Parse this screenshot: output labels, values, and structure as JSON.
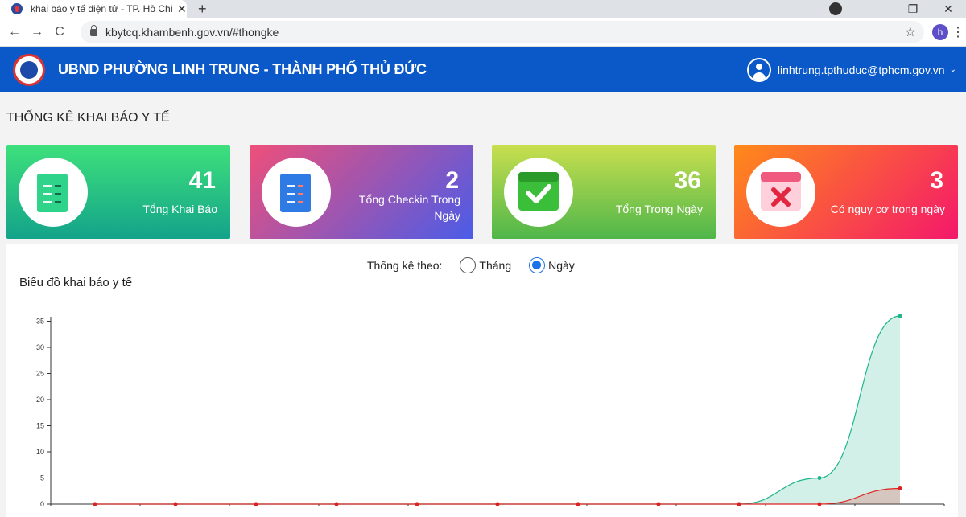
{
  "browser": {
    "tab_title": "khai báo y tế điện tử - TP. Hồ Chí",
    "tab_close": "✕",
    "new_tab": "+",
    "url": "kbytcq.khambenh.gov.vn/#thongke",
    "profile_initial": "h",
    "back": "←",
    "forward": "→",
    "reload": "C",
    "star": "☆",
    "menu": "⋮",
    "minimize": "—",
    "maximize": "❐",
    "close": "✕"
  },
  "header": {
    "title": "UBND PHƯỜNG LINH TRUNG - THÀNH PHỐ THỦ ĐỨC",
    "user_email": "linhtrung.tpthuduc@tphcm.gov.vn"
  },
  "page": {
    "title": "THỐNG KÊ KHAI BÁO Y TẾ"
  },
  "cards": [
    {
      "value": "41",
      "label": "Tổng Khai Báo",
      "icon": "document-check-icon"
    },
    {
      "value": "2",
      "label": "Tổng Checkin Trong Ngày",
      "icon": "document-x-icon"
    },
    {
      "value": "36",
      "label": "Tổng Trong Ngày",
      "icon": "calendar-check-icon"
    },
    {
      "value": "3",
      "label": "Có nguy cơ trong ngày",
      "icon": "calendar-x-icon"
    }
  ],
  "filter": {
    "label": "Thống kê theo:",
    "options": [
      "Tháng",
      "Ngày"
    ],
    "selected": "Ngày"
  },
  "colors": {
    "header_bg": "#0b59c9",
    "series_total": "#1db58a",
    "series_risk": "#e02020"
  },
  "chart_data": {
    "type": "area",
    "title": "Biểu đồ khai báo y tế",
    "ylim": [
      0,
      38
    ],
    "yticks": [
      0,
      5,
      10,
      15,
      20,
      25,
      30,
      35
    ],
    "x": [
      0,
      1,
      2,
      3,
      4,
      5,
      6,
      7,
      8,
      9,
      10
    ],
    "series": [
      {
        "values": [
          0,
          0,
          0,
          0,
          0,
          0,
          0,
          0,
          0,
          5,
          36
        ],
        "color": "#1db58a"
      },
      {
        "values": [
          0,
          0,
          0,
          0,
          0,
          0,
          0,
          0,
          0,
          0,
          3
        ],
        "color": "#e02020"
      }
    ]
  }
}
